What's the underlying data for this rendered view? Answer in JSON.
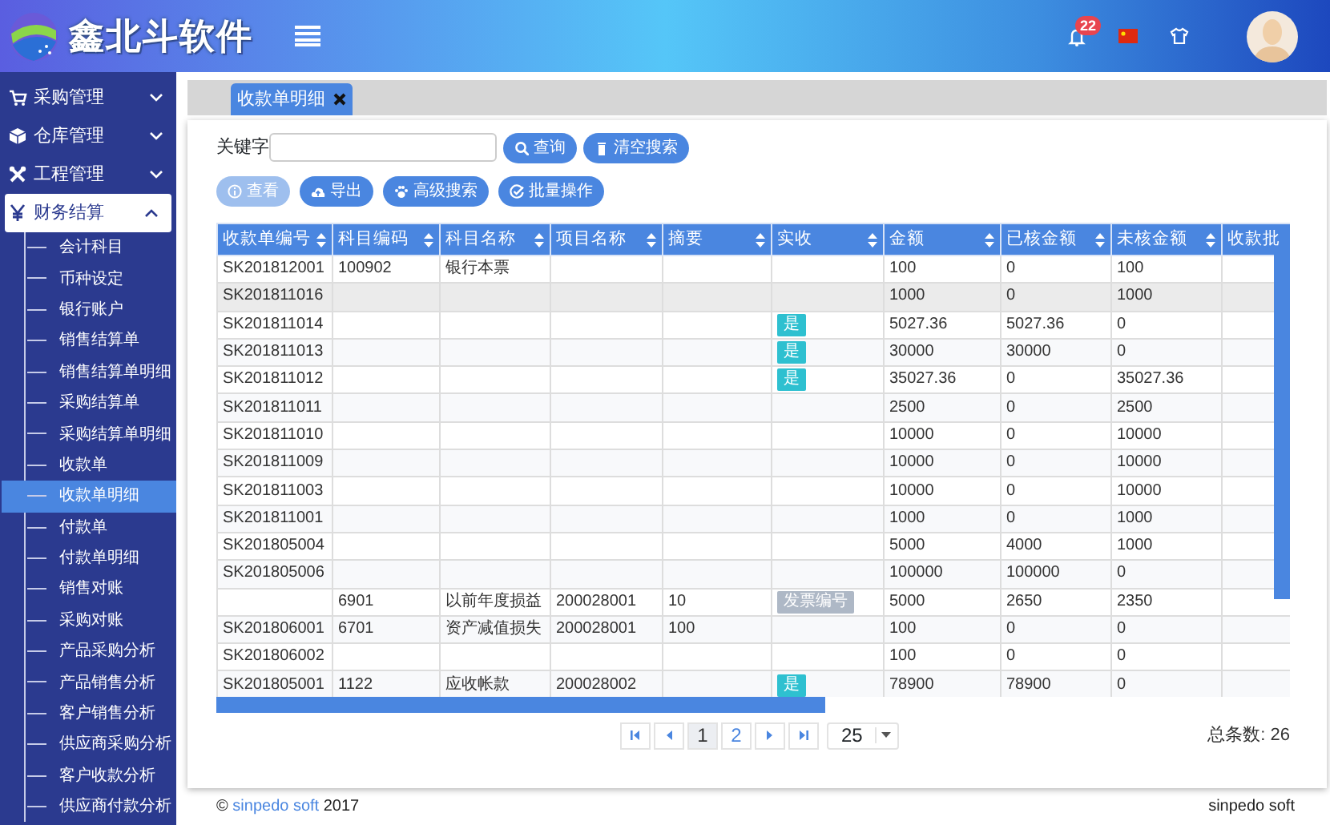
{
  "header": {
    "logo_text": "鑫北斗软件",
    "notification_count": "22"
  },
  "sidebar": {
    "items": [
      {
        "label": "采购管理",
        "kind": "cart",
        "expanded": false
      },
      {
        "label": "仓库管理",
        "kind": "cube",
        "expanded": false
      },
      {
        "label": "工程管理",
        "kind": "tools",
        "expanded": false
      },
      {
        "label": "财务结算",
        "kind": "yen",
        "expanded": true,
        "children": [
          {
            "label": "会计科目",
            "selected": false
          },
          {
            "label": "币种设定",
            "selected": false
          },
          {
            "label": "银行账户",
            "selected": false
          },
          {
            "label": "销售结算单",
            "selected": false
          },
          {
            "label": "销售结算单明细",
            "selected": false
          },
          {
            "label": "采购结算单",
            "selected": false
          },
          {
            "label": "采购结算单明细",
            "selected": false
          },
          {
            "label": "收款单",
            "selected": false
          },
          {
            "label": "收款单明细",
            "selected": true
          },
          {
            "label": "付款单",
            "selected": false
          },
          {
            "label": "付款单明细",
            "selected": false
          },
          {
            "label": "销售对账",
            "selected": false
          },
          {
            "label": "采购对账",
            "selected": false
          },
          {
            "label": "产品采购分析",
            "selected": false
          },
          {
            "label": "产品销售分析",
            "selected": false
          },
          {
            "label": "客户销售分析",
            "selected": false
          },
          {
            "label": "供应商采购分析",
            "selected": false
          },
          {
            "label": "客户收款分析",
            "selected": false
          },
          {
            "label": "供应商付款分析",
            "selected": false
          }
        ]
      }
    ]
  },
  "tabs": [
    {
      "label": "收款单明细",
      "selected": true
    }
  ],
  "search": {
    "label": "关键字",
    "buttons": [
      {
        "label": "查询",
        "kind": "search"
      },
      {
        "label": "清空搜索",
        "kind": "trash"
      }
    ]
  },
  "toolbar": [
    {
      "label": "查看",
      "kind": "info",
      "disabled": true
    },
    {
      "label": "导出",
      "kind": "cloud",
      "disabled": false
    },
    {
      "label": "高级搜索",
      "kind": "paw",
      "disabled": false
    },
    {
      "label": "批量操作",
      "kind": "check",
      "disabled": false
    }
  ],
  "table": {
    "columns": [
      {
        "label": "收款单编号",
        "sortable": true
      },
      {
        "label": "科目编码",
        "sortable": true
      },
      {
        "label": "科目名称",
        "sortable": true
      },
      {
        "label": "项目名称",
        "sortable": true
      },
      {
        "label": "摘要",
        "sortable": true
      },
      {
        "label": "实收",
        "sortable": true
      },
      {
        "label": "金额",
        "sortable": true
      },
      {
        "label": "已核金额",
        "sortable": true
      },
      {
        "label": "未核金额",
        "sortable": true
      },
      {
        "label": "收款批"
      }
    ],
    "rows": [
      {
        "selected": false,
        "cells": {
          "code": "SK201812001",
          "subject_code": "100902",
          "subject_name": "银行本票",
          "amount": "100",
          "verified": "0",
          "unverified": "100"
        }
      },
      {
        "selected": true,
        "cells": {
          "code": "SK201811016",
          "amount": "1000",
          "verified": "0",
          "unverified": "1000"
        }
      },
      {
        "selected": false,
        "cells": {
          "code": "SK201811014",
          "received": {
            "text": "是",
            "kind": "yes"
          },
          "amount": "5027.36",
          "verified": "5027.36",
          "unverified": "0"
        }
      },
      {
        "selected": false,
        "cells": {
          "code": "SK201811013",
          "received": {
            "text": "是",
            "kind": "yes"
          },
          "amount": "30000",
          "verified": "30000",
          "unverified": "0"
        }
      },
      {
        "selected": false,
        "cells": {
          "code": "SK201811012",
          "received": {
            "text": "是",
            "kind": "yes"
          },
          "amount": "35027.36",
          "verified": "0",
          "unverified": "35027.36"
        }
      },
      {
        "selected": false,
        "cells": {
          "code": "SK201811011",
          "amount": "2500",
          "verified": "0",
          "unverified": "2500"
        }
      },
      {
        "selected": false,
        "cells": {
          "code": "SK201811010",
          "amount": "10000",
          "verified": "0",
          "unverified": "10000"
        }
      },
      {
        "selected": false,
        "cells": {
          "code": "SK201811009",
          "amount": "10000",
          "verified": "0",
          "unverified": "10000"
        }
      },
      {
        "selected": false,
        "cells": {
          "code": "SK201811003",
          "amount": "10000",
          "verified": "0",
          "unverified": "10000"
        }
      },
      {
        "selected": false,
        "cells": {
          "code": "SK201811001",
          "amount": "1000",
          "verified": "0",
          "unverified": "1000"
        }
      },
      {
        "selected": false,
        "cells": {
          "code": "SK201805004",
          "amount": "5000",
          "verified": "4000",
          "unverified": "1000"
        }
      },
      {
        "selected": false,
        "cells": {
          "code": "SK201805006",
          "amount": "100000",
          "verified": "100000",
          "unverified": "0"
        }
      },
      {
        "selected": false,
        "cells": {
          "subject_code": "6901",
          "subject_name": "以前年度损益",
          "project_name": "200028001",
          "summary": "10",
          "received": {
            "text": "发票编号",
            "kind": "invoice"
          },
          "amount": "5000",
          "verified": "2650",
          "unverified": "2350"
        }
      },
      {
        "selected": false,
        "cells": {
          "code": "SK201806001",
          "subject_code": "6701",
          "subject_name": "资产减值损失",
          "project_name": "200028001",
          "summary": "100",
          "amount": "100",
          "verified": "0",
          "unverified": "0"
        }
      },
      {
        "selected": false,
        "cells": {
          "code": "SK201806002",
          "amount": "100",
          "verified": "0",
          "unverified": "0"
        }
      },
      {
        "selected": false,
        "cells": {
          "code": "SK201805001",
          "subject_code": "1122",
          "subject_name": "应收帐款",
          "project_name": "200028002",
          "received": {
            "text": "是",
            "kind": "yes"
          },
          "amount": "78900",
          "verified": "78900",
          "unverified": "0"
        }
      }
    ]
  },
  "pagination": {
    "pages": [
      {
        "label": "1",
        "selected": true
      },
      {
        "label": "2",
        "selected": false
      }
    ],
    "page_size": "25",
    "total": "总条数: 26"
  },
  "footer": {
    "copyright": "©",
    "link": "sinpedo soft",
    "year": "2017",
    "brand": "sinpedo soft"
  }
}
